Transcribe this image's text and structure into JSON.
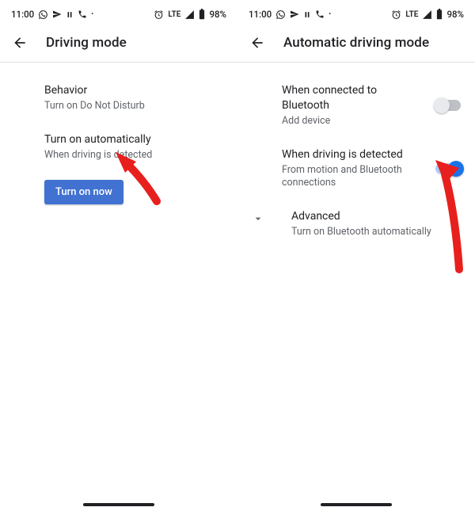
{
  "status": {
    "time": "11:00",
    "network": "LTE",
    "battery": "98%"
  },
  "left": {
    "title": "Driving mode",
    "rows": {
      "behavior": {
        "primary": "Behavior",
        "secondary": "Turn on Do Not Disturb"
      },
      "auto": {
        "primary": "Turn on automatically",
        "secondary": "When driving is detected"
      }
    },
    "button": "Turn on now"
  },
  "right": {
    "title": "Automatic driving mode",
    "rows": {
      "bt": {
        "primary": "When connected to Bluetooth",
        "secondary": "Add device"
      },
      "detect": {
        "primary": "When driving is detected",
        "secondary": "From motion and Bluetooth connections"
      },
      "adv": {
        "primary": "Advanced",
        "secondary": "Turn on Bluetooth automatically"
      }
    }
  }
}
